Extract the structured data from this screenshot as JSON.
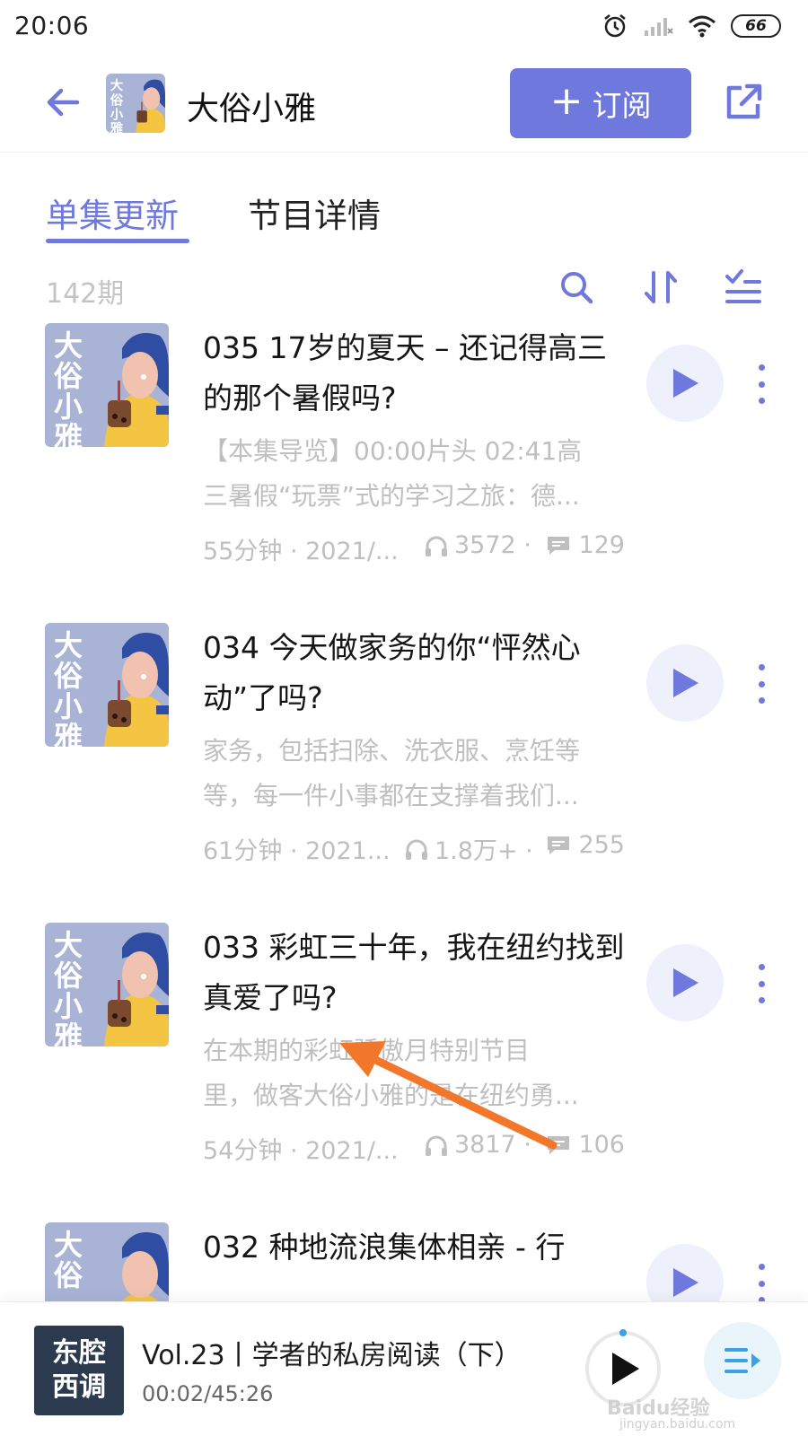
{
  "status_bar": {
    "time": "20:06",
    "battery": "66",
    "icons": [
      "alarm-icon",
      "signal-icon",
      "wifi-icon",
      "battery-icon"
    ]
  },
  "header": {
    "title": "大俗小雅",
    "cover_text": "大俗小雅",
    "subscribe_label": "订阅",
    "icons": [
      "back-arrow-icon",
      "share-icon"
    ]
  },
  "tabs": [
    {
      "label": "单集更新",
      "active": true
    },
    {
      "label": "节目详情",
      "active": false
    }
  ],
  "toolbar": {
    "episode_count": "142期",
    "icons": [
      "search-icon",
      "sort-icon",
      "multi-select-icon"
    ]
  },
  "cover_art": {
    "text": [
      "大",
      "俗",
      "小",
      "雅"
    ]
  },
  "episodes": [
    {
      "title": "035 17岁的夏天 – 还记得高三的那个暑假吗?",
      "desc_line1": "【本集导览】00:00片头 02:41高",
      "desc_line2": "三暑假“玩票”式的学习之旅：德...",
      "duration": "55分钟 · 2021/...",
      "plays": "3572 ·",
      "comments": "129"
    },
    {
      "title": "034 今天做家务的你“怦然心动”了吗?",
      "desc_line1": "家务，包括扫除、洗衣服、烹饪等",
      "desc_line2": "等，每一件小事都在支撑着我们...",
      "duration": "61分钟 · 2021...",
      "plays": "1.8万+ ·",
      "comments": "255"
    },
    {
      "title": "033 彩虹三十年，我在纽约找到真爱了吗?",
      "desc_line1": "在本期的彩虹骄傲月特别节目",
      "desc_line2": "里，做客大俗小雅的是在纽约勇...",
      "duration": "54分钟 · 2021/...",
      "plays": "3817 ·",
      "comments": "106"
    },
    {
      "title": "032 种地流浪集体相亲 - 行",
      "desc_line1": "",
      "desc_line2": "",
      "duration": "",
      "plays": "",
      "comments": ""
    }
  ],
  "mini_player": {
    "cover_line1": "东腔",
    "cover_line2": "西调",
    "title": "Vol.23丨学者的私房阅读（下）",
    "time": "00:02/45:26"
  },
  "watermark": {
    "text": "Baidu经验",
    "sub": "jingyan.baidu.com"
  },
  "colors": {
    "accent": "#6f78dd",
    "muted": "#bfbfbf",
    "arrow": "#f2772a",
    "cover_bg": "#a9b3d5",
    "cover_yellow": "#f4c542",
    "cover_blue": "#2f4ea3"
  }
}
